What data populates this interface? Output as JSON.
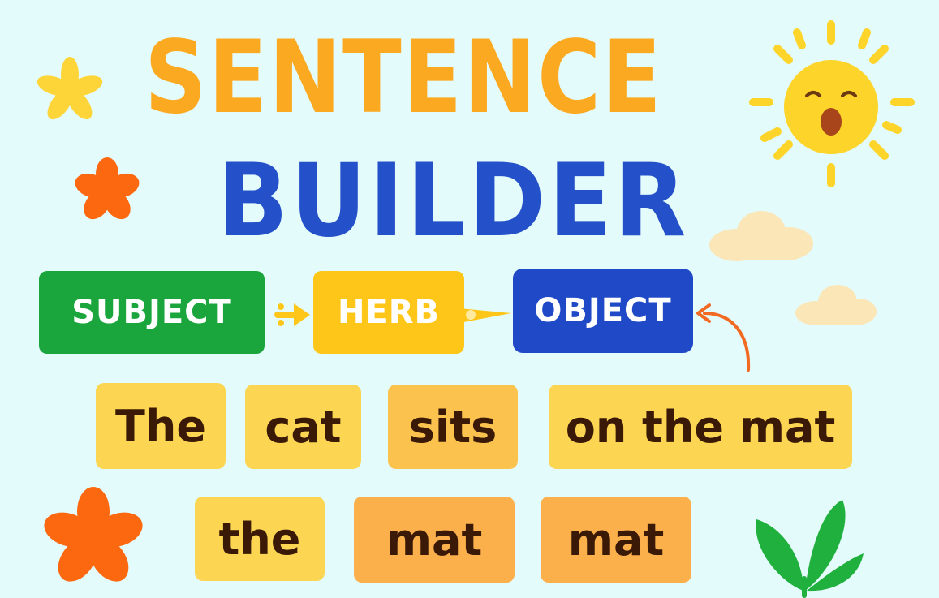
{
  "title": {
    "line1": "SENTENCE",
    "line2": "BUILDER"
  },
  "labels": {
    "subject": "SUBJECT",
    "herb": "HERB",
    "object": "OBJECT"
  },
  "words": {
    "row1": [
      "The",
      "cat",
      "sits",
      "on the mat"
    ],
    "row2": [
      "the",
      "mat",
      "mat"
    ]
  },
  "colors": {
    "background": "#e4fbfb",
    "title_line1": "#fca922",
    "title_line2": "#2451c9",
    "subject": "#1aa63c",
    "herb": "#fec619",
    "object": "#1f49c6",
    "tile_yellow": "#fcd552",
    "tile_orange": "#fbb04c",
    "word_text": "#3a1a06",
    "flower_orange": "#fc680f",
    "flower_yellow": "#fed538",
    "sun": "#fdd42a",
    "leaf": "#20b03d",
    "arrow": "#f26a22"
  },
  "icons": [
    "star-flower-icon",
    "orange-flower-icon",
    "sun-face-icon",
    "cloud-icon",
    "leaf-plant-icon",
    "curved-arrow-icon"
  ]
}
